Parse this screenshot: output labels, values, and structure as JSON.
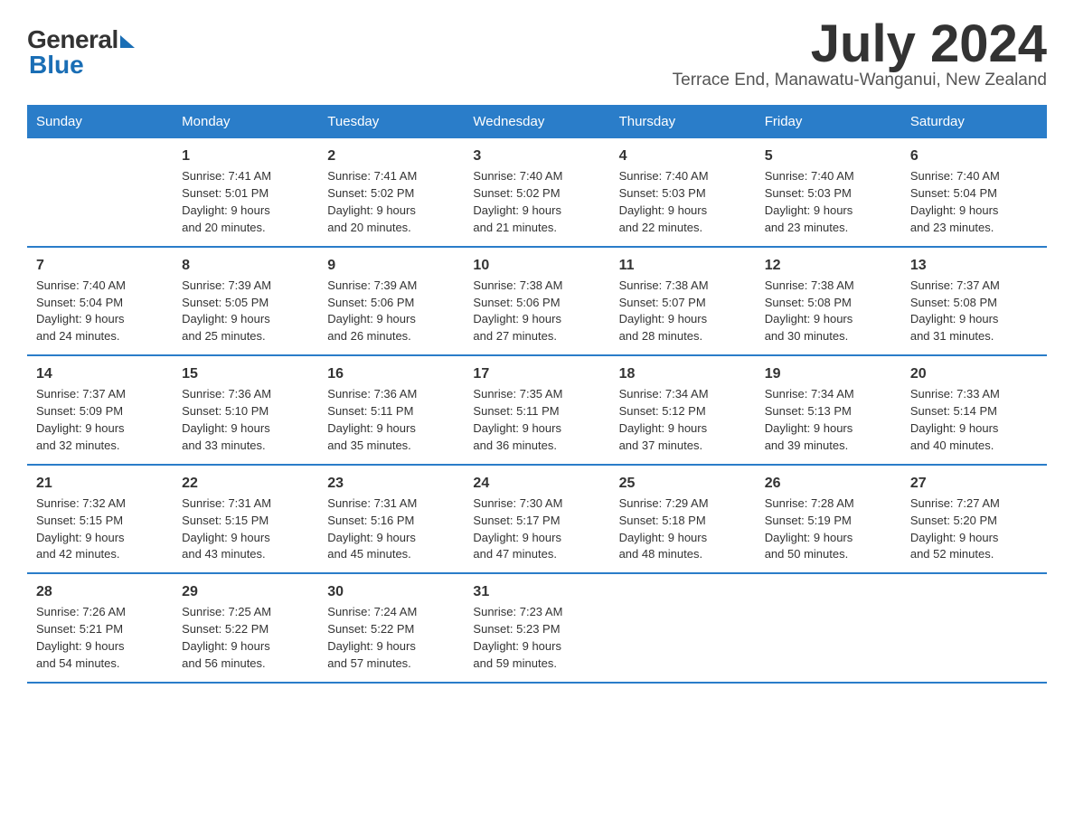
{
  "logo": {
    "general": "General",
    "blue": "Blue"
  },
  "title": "July 2024",
  "subtitle": "Terrace End, Manawatu-Wanganui, New Zealand",
  "headers": [
    "Sunday",
    "Monday",
    "Tuesday",
    "Wednesday",
    "Thursday",
    "Friday",
    "Saturday"
  ],
  "weeks": [
    [
      {
        "day": "",
        "info": ""
      },
      {
        "day": "1",
        "info": "Sunrise: 7:41 AM\nSunset: 5:01 PM\nDaylight: 9 hours\nand 20 minutes."
      },
      {
        "day": "2",
        "info": "Sunrise: 7:41 AM\nSunset: 5:02 PM\nDaylight: 9 hours\nand 20 minutes."
      },
      {
        "day": "3",
        "info": "Sunrise: 7:40 AM\nSunset: 5:02 PM\nDaylight: 9 hours\nand 21 minutes."
      },
      {
        "day": "4",
        "info": "Sunrise: 7:40 AM\nSunset: 5:03 PM\nDaylight: 9 hours\nand 22 minutes."
      },
      {
        "day": "5",
        "info": "Sunrise: 7:40 AM\nSunset: 5:03 PM\nDaylight: 9 hours\nand 23 minutes."
      },
      {
        "day": "6",
        "info": "Sunrise: 7:40 AM\nSunset: 5:04 PM\nDaylight: 9 hours\nand 23 minutes."
      }
    ],
    [
      {
        "day": "7",
        "info": "Sunrise: 7:40 AM\nSunset: 5:04 PM\nDaylight: 9 hours\nand 24 minutes."
      },
      {
        "day": "8",
        "info": "Sunrise: 7:39 AM\nSunset: 5:05 PM\nDaylight: 9 hours\nand 25 minutes."
      },
      {
        "day": "9",
        "info": "Sunrise: 7:39 AM\nSunset: 5:06 PM\nDaylight: 9 hours\nand 26 minutes."
      },
      {
        "day": "10",
        "info": "Sunrise: 7:38 AM\nSunset: 5:06 PM\nDaylight: 9 hours\nand 27 minutes."
      },
      {
        "day": "11",
        "info": "Sunrise: 7:38 AM\nSunset: 5:07 PM\nDaylight: 9 hours\nand 28 minutes."
      },
      {
        "day": "12",
        "info": "Sunrise: 7:38 AM\nSunset: 5:08 PM\nDaylight: 9 hours\nand 30 minutes."
      },
      {
        "day": "13",
        "info": "Sunrise: 7:37 AM\nSunset: 5:08 PM\nDaylight: 9 hours\nand 31 minutes."
      }
    ],
    [
      {
        "day": "14",
        "info": "Sunrise: 7:37 AM\nSunset: 5:09 PM\nDaylight: 9 hours\nand 32 minutes."
      },
      {
        "day": "15",
        "info": "Sunrise: 7:36 AM\nSunset: 5:10 PM\nDaylight: 9 hours\nand 33 minutes."
      },
      {
        "day": "16",
        "info": "Sunrise: 7:36 AM\nSunset: 5:11 PM\nDaylight: 9 hours\nand 35 minutes."
      },
      {
        "day": "17",
        "info": "Sunrise: 7:35 AM\nSunset: 5:11 PM\nDaylight: 9 hours\nand 36 minutes."
      },
      {
        "day": "18",
        "info": "Sunrise: 7:34 AM\nSunset: 5:12 PM\nDaylight: 9 hours\nand 37 minutes."
      },
      {
        "day": "19",
        "info": "Sunrise: 7:34 AM\nSunset: 5:13 PM\nDaylight: 9 hours\nand 39 minutes."
      },
      {
        "day": "20",
        "info": "Sunrise: 7:33 AM\nSunset: 5:14 PM\nDaylight: 9 hours\nand 40 minutes."
      }
    ],
    [
      {
        "day": "21",
        "info": "Sunrise: 7:32 AM\nSunset: 5:15 PM\nDaylight: 9 hours\nand 42 minutes."
      },
      {
        "day": "22",
        "info": "Sunrise: 7:31 AM\nSunset: 5:15 PM\nDaylight: 9 hours\nand 43 minutes."
      },
      {
        "day": "23",
        "info": "Sunrise: 7:31 AM\nSunset: 5:16 PM\nDaylight: 9 hours\nand 45 minutes."
      },
      {
        "day": "24",
        "info": "Sunrise: 7:30 AM\nSunset: 5:17 PM\nDaylight: 9 hours\nand 47 minutes."
      },
      {
        "day": "25",
        "info": "Sunrise: 7:29 AM\nSunset: 5:18 PM\nDaylight: 9 hours\nand 48 minutes."
      },
      {
        "day": "26",
        "info": "Sunrise: 7:28 AM\nSunset: 5:19 PM\nDaylight: 9 hours\nand 50 minutes."
      },
      {
        "day": "27",
        "info": "Sunrise: 7:27 AM\nSunset: 5:20 PM\nDaylight: 9 hours\nand 52 minutes."
      }
    ],
    [
      {
        "day": "28",
        "info": "Sunrise: 7:26 AM\nSunset: 5:21 PM\nDaylight: 9 hours\nand 54 minutes."
      },
      {
        "day": "29",
        "info": "Sunrise: 7:25 AM\nSunset: 5:22 PM\nDaylight: 9 hours\nand 56 minutes."
      },
      {
        "day": "30",
        "info": "Sunrise: 7:24 AM\nSunset: 5:22 PM\nDaylight: 9 hours\nand 57 minutes."
      },
      {
        "day": "31",
        "info": "Sunrise: 7:23 AM\nSunset: 5:23 PM\nDaylight: 9 hours\nand 59 minutes."
      },
      {
        "day": "",
        "info": ""
      },
      {
        "day": "",
        "info": ""
      },
      {
        "day": "",
        "info": ""
      }
    ]
  ]
}
